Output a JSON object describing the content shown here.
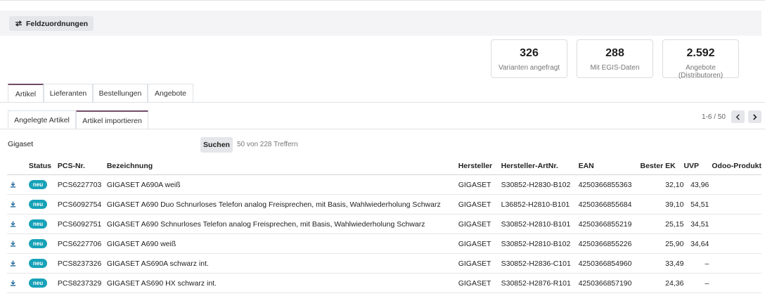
{
  "toolbar": {
    "field_mapping_label": "Feldzuordnungen",
    "field_mapping_icon": "swap-arrows-icon"
  },
  "stats": [
    {
      "value": "326",
      "label": "Varianten angefragt"
    },
    {
      "value": "288",
      "label": "Mit EGIS-Daten"
    },
    {
      "value": "2.592",
      "label": "Angebote (Distributoren)"
    }
  ],
  "main_tabs": [
    {
      "label": "Artikel",
      "active": true
    },
    {
      "label": "Lieferanten",
      "active": false
    },
    {
      "label": "Bestellungen",
      "active": false
    },
    {
      "label": "Angebote",
      "active": false
    }
  ],
  "sub_tabs": [
    {
      "label": "Angelegte Artikel",
      "active": false
    },
    {
      "label": "Artikel importieren",
      "active": true
    }
  ],
  "pager": {
    "text": "1-6 / 50"
  },
  "search": {
    "value": "Gigaset",
    "button_label": "Suchen",
    "hits": "50 von 228 Treffern"
  },
  "table": {
    "columns": [
      "Status",
      "PCS-Nr.",
      "Bezeichnung",
      "Hersteller",
      "Hersteller-ArtNr.",
      "EAN",
      "Bester EK",
      "UVP",
      "Odoo-Produkt"
    ],
    "rows": [
      {
        "status": "neu",
        "pcs": "PCS6227703",
        "name": "GIGASET A690A weiß",
        "maker": "GIGASET",
        "maker_no": "S30852-H2830-B102",
        "ean": "4250366855363",
        "best_ek": "32,10",
        "uvp": "43,96",
        "odoo": ""
      },
      {
        "status": "neu",
        "pcs": "PCS6092754",
        "name": "GIGASET A690 Duo Schnurloses Telefon analog Freisprechen, mit Basis, Wahlwiederholung Schwarz",
        "maker": "GIGASET",
        "maker_no": "L36852-H2810-B101",
        "ean": "4250366855684",
        "best_ek": "39,10",
        "uvp": "54,51",
        "odoo": ""
      },
      {
        "status": "neu",
        "pcs": "PCS6092751",
        "name": "GIGASET A690 Schnurloses Telefon analog Freisprechen, mit Basis, Wahlwiederholung Schwarz",
        "maker": "GIGASET",
        "maker_no": "S30852-H2810-B101",
        "ean": "4250366855219",
        "best_ek": "25,15",
        "uvp": "34,51",
        "odoo": ""
      },
      {
        "status": "neu",
        "pcs": "PCS6227706",
        "name": "GIGASET A690 weiß",
        "maker": "GIGASET",
        "maker_no": "S30852-H2810-B102",
        "ean": "4250366855226",
        "best_ek": "25,90",
        "uvp": "34,64",
        "odoo": ""
      },
      {
        "status": "neu",
        "pcs": "PCS8237326",
        "name": "GIGASET AS690A schwarz int.",
        "maker": "GIGASET",
        "maker_no": "S30852-H2836-C101",
        "ean": "4250366854960",
        "best_ek": "33,49",
        "uvp": "–",
        "odoo": ""
      },
      {
        "status": "neu",
        "pcs": "PCS8237329",
        "name": "GIGASET AS690 HX schwarz int.",
        "maker": "GIGASET",
        "maker_no": "S30852-H2876-R101",
        "ean": "4250366857190",
        "best_ek": "24,36",
        "uvp": "–",
        "odoo": ""
      }
    ]
  },
  "colors": {
    "accent": "#714b67",
    "badge": "#17a2b8",
    "download_icon": "#2b6f9f"
  }
}
